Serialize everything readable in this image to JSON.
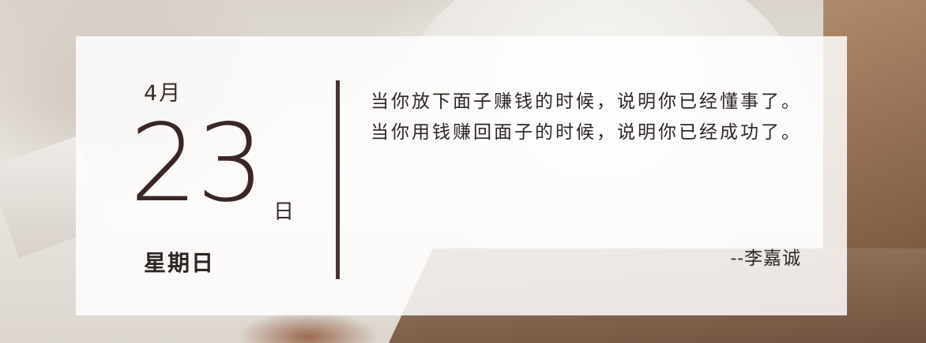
{
  "calendar": {
    "month": "4月",
    "day": "23",
    "day_unit": "日",
    "weekday": "星期日"
  },
  "quote": {
    "text": "当你放下面子赚钱的时候，说明你已经懂事了。当你用钱赚回面子的时候，说明你已经成功了。",
    "author": "--李嘉诚"
  },
  "colors": {
    "text": "#3a2626",
    "divider": "#4b3232"
  }
}
